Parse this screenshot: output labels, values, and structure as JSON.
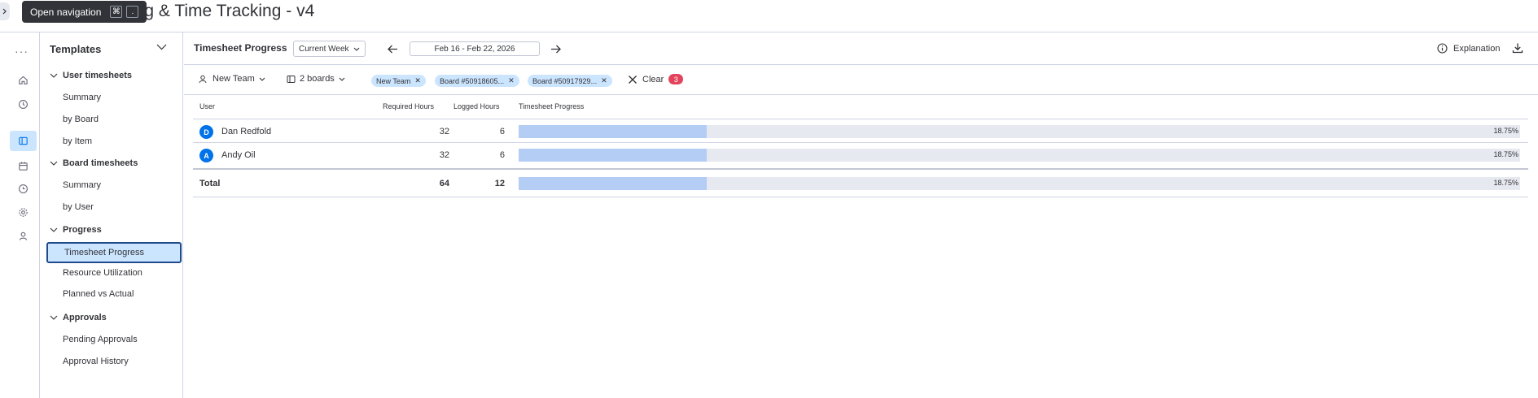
{
  "app": {
    "title": "ing & Time Tracking - v4"
  },
  "tooltip": {
    "text": "Open navigation",
    "keys": [
      "⌘",
      "."
    ]
  },
  "rail": {
    "more": "···"
  },
  "sidebar": {
    "header": "Templates",
    "sections": [
      {
        "label": "User timesheets",
        "items": [
          "Summary",
          "by Board",
          "by Item"
        ]
      },
      {
        "label": "Board timesheets",
        "items": [
          "Summary",
          "by User"
        ]
      },
      {
        "label": "Progress",
        "items": [
          "Timesheet Progress",
          "Resource Utilization",
          "Planned vs Actual"
        ]
      },
      {
        "label": "Approvals",
        "items": [
          "Pending Approvals",
          "Approval History"
        ]
      }
    ],
    "active_item": "Timesheet Progress"
  },
  "toolbar": {
    "title": "Timesheet Progress",
    "period": "Current Week",
    "date_range": "Feb 16 - Feb 22, 2026",
    "explanation": "Explanation"
  },
  "filters": {
    "team": "New Team",
    "boards": "2 boards",
    "chips": [
      "New Team",
      "Board #50918605...",
      "Board #50917929..."
    ],
    "clear": "Clear",
    "count": "3"
  },
  "table": {
    "headers": [
      "User",
      "Required Hours",
      "Logged Hours",
      "Timesheet Progress"
    ],
    "rows": [
      {
        "initial": "D",
        "user": "Dan Redfold",
        "required": "32",
        "logged": "6",
        "progress_label": "18.75%",
        "progress": 0.1875
      },
      {
        "initial": "A",
        "user": "Andy Oil",
        "required": "32",
        "logged": "6",
        "progress_label": "18.75%",
        "progress": 0.1875
      }
    ],
    "total": {
      "label": "Total",
      "required": "64",
      "logged": "12",
      "progress_label": "18.75%",
      "progress": 0.1875
    }
  },
  "colors": {
    "accent": "#0073ea",
    "selected": "#cce5ff",
    "bar_fill": "#b3cdf4",
    "bar_track": "#e6e9ef",
    "badge": "#e2445c"
  }
}
